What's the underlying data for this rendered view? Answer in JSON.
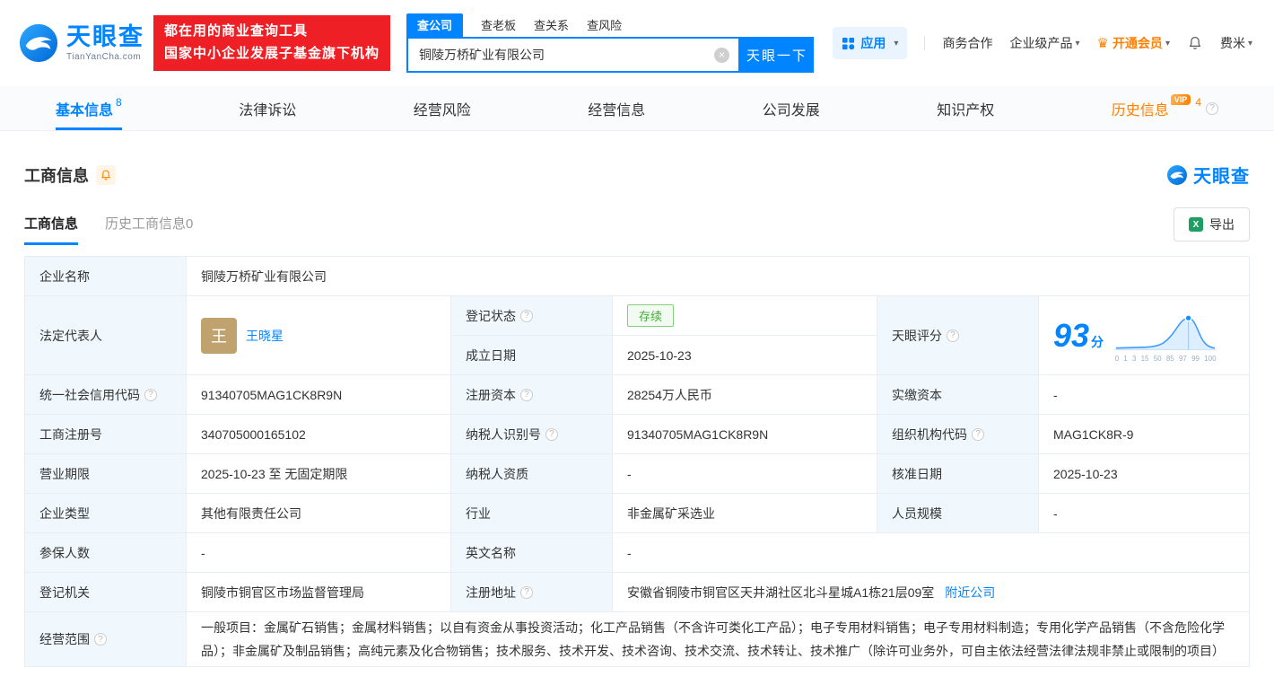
{
  "colors": {
    "accent": "#0084ff",
    "orange": "#ff8000",
    "red": "#ee1f25",
    "green": "#3fae36"
  },
  "header": {
    "logo_title": "天眼查",
    "logo_sub": "TianYanCha.com",
    "banner_line1": "都在用的商业查询工具",
    "banner_line2": "国家中小企业发展子基金旗下机构",
    "search_tabs": [
      {
        "label": "查公司"
      },
      {
        "label": "查老板"
      },
      {
        "label": "查关系"
      },
      {
        "label": "查风险"
      }
    ],
    "search_value": "铜陵万桥矿业有限公司",
    "search_button": "天眼一下",
    "nav": {
      "apps": "应用",
      "biz": "商务合作",
      "enterprise": "企业级产品",
      "vip": "开通会员",
      "user": "费米"
    }
  },
  "tabs": {
    "vip_tag": "VIP",
    "items": [
      {
        "label": "基本信息",
        "badge": "8"
      },
      {
        "label": "法律诉讼",
        "badge": ""
      },
      {
        "label": "经营风险",
        "badge": ""
      },
      {
        "label": "经营信息",
        "badge": ""
      },
      {
        "label": "公司发展",
        "badge": ""
      },
      {
        "label": "知识产权",
        "badge": ""
      },
      {
        "label": "历史信息",
        "badge": "4"
      }
    ]
  },
  "section": {
    "title": "工商信息",
    "brand": "天眼查",
    "subtab_active": "工商信息",
    "subtab_history": "历史工商信息0",
    "export": "导出"
  },
  "info": {
    "company_name_label": "企业名称",
    "company_name": "铜陵万桥矿业有限公司",
    "legal_rep_label": "法定代表人",
    "legal_rep_avatar": "王",
    "legal_rep_name": "王晓星",
    "reg_status_label": "登记状态",
    "reg_status": "存续",
    "establish_date_label": "成立日期",
    "establish_date": "2025-10-23",
    "score_label": "天眼评分",
    "score": "93",
    "score_unit": "分",
    "score_axis": "0 1 3 15 50 85 97 99 100",
    "credit_code_label": "统一社会信用代码",
    "credit_code": "91340705MAG1CK8R9N",
    "reg_capital_label": "注册资本",
    "reg_capital": "28254万人民币",
    "paid_capital_label": "实缴资本",
    "paid_capital": "-",
    "reg_number_label": "工商注册号",
    "reg_number": "340705000165102",
    "taxpayer_id_label": "纳税人识别号",
    "taxpayer_id": "91340705MAG1CK8R9N",
    "org_code_label": "组织机构代码",
    "org_code": "MAG1CK8R-9",
    "business_term_label": "营业期限",
    "business_term": "2025-10-23 至 无固定期限",
    "taxpayer_quality_label": "纳税人资质",
    "taxpayer_quality": "-",
    "approval_date_label": "核准日期",
    "approval_date": "2025-10-23",
    "company_type_label": "企业类型",
    "company_type": "其他有限责任公司",
    "industry_label": "行业",
    "industry": "非金属矿采选业",
    "staff_size_label": "人员规模",
    "staff_size": "-",
    "insured_label": "参保人数",
    "insured": "-",
    "english_name_label": "英文名称",
    "english_name": "-",
    "registry_label": "登记机关",
    "registry": "铜陵市铜官区市场监督管理局",
    "address_label": "注册地址",
    "address": "安徽省铜陵市铜官区天井湖社区北斗星城A1栋21层09室",
    "nearby_link": "附近公司",
    "scope_label": "经营范围",
    "scope": "一般项目：金属矿石销售；金属材料销售；以自有资金从事投资活动；化工产品销售（不含许可类化工产品）；电子专用材料销售；电子专用材料制造；专用化学产品销售（不含危险化学品）；非金属矿及制品销售；高纯元素及化合物销售；技术服务、技术开发、技术咨询、技术交流、技术转让、技术推广（除许可业务外，可自主依法经营法律法规非禁止或限制的项目）"
  }
}
